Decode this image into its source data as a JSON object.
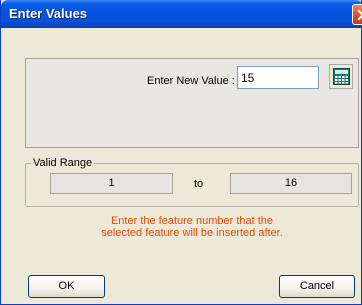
{
  "window": {
    "title": "Enter Values"
  },
  "form": {
    "new_value_label": "Enter New Value :",
    "new_value": "15"
  },
  "range": {
    "group_label": "Valid Range",
    "min": "1",
    "to_label": "to",
    "max": "16"
  },
  "hint": {
    "line1": "Enter the feature number that the",
    "line2": "selected feature will be inserted after."
  },
  "buttons": {
    "ok_label": "OK",
    "cancel_label": "Cancel"
  },
  "icons": {
    "close": "close-icon",
    "calculator": "calculator-icon"
  },
  "colors": {
    "titlebar": "#0551e0",
    "hint_text": "#e24b06",
    "close_button": "#d5532e"
  }
}
